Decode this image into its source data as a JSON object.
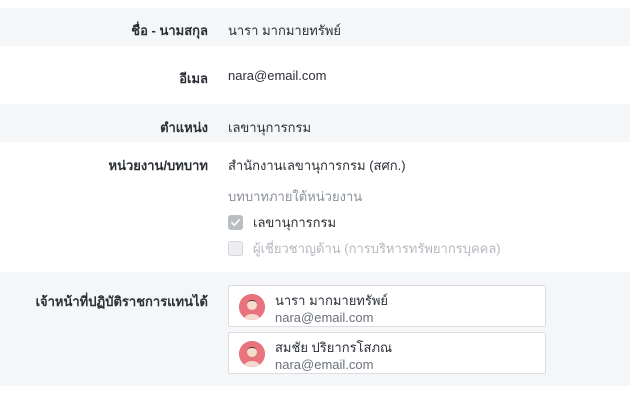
{
  "fields": {
    "name": {
      "label": "ชื่อ - นามสกุล",
      "value": "นารา มากมายทรัพย์"
    },
    "email": {
      "label": "อีเมล",
      "value": "nara@email.com"
    },
    "position": {
      "label": "ตำแหน่ง",
      "value": "เลขานุการกรม"
    },
    "unit": {
      "label": "หน่วยงาน/บทบาท",
      "value": "สำนักงานเลขานุการกรม (สศก.)",
      "roles_heading": "บทบาทภายใต้หน่วยงาน",
      "roles": [
        {
          "label": "เลขานุการกรม",
          "checked": true,
          "disabled": false
        },
        {
          "label": "ผู้เชี่ยวชาญด้าน (การบริหารทรัพยากรบุคคล)",
          "checked": false,
          "disabled": true
        }
      ]
    },
    "delegates": {
      "label": "เจ้าหน้าที่ปฏิบัติราชการแทนได้",
      "people": [
        {
          "name": "นารา มากมายทรัพย์",
          "email": "nara@email.com"
        },
        {
          "name": "สมชัย ปริยากรโสภณ",
          "email": "nara@email.com"
        }
      ]
    }
  },
  "colors": {
    "row_shade": "#f5f6f8",
    "avatar_bg": "#e8737c",
    "checkbox_checked": "#b9bdc4"
  }
}
